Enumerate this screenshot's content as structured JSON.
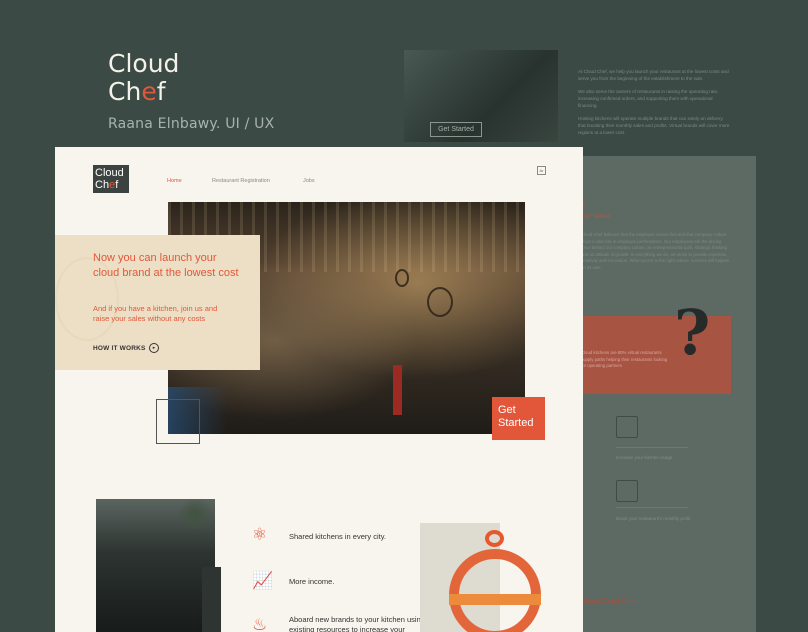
{
  "title_block": {
    "brand_line1": "Cloud",
    "brand_line2_pre": "Ch",
    "brand_line2_o": "e",
    "brand_line2_post": "f",
    "credit": "Raana Elnbawy.  UI / UX"
  },
  "bg_mock": {
    "get_started": "Get Started",
    "paragraphs": [
      "At Cloud Chef, we help you launch your restaurant at the lowest costs and serve you from the beginning of the establishment to the sale.",
      "We also serve the owners of restaurants in raising the operating rate, increasing confirmed orders, and supporting them with operational financing.",
      "Hosting kitchens will operate multiple brands that can solely an delivery that boosting their monthly sales and profits. Virtual brands will cover more regions at a lower cost."
    ]
  },
  "right_page": {
    "values_title": "Our Values",
    "values_text": "Cloud Chef believes that the employee comes first and that company culture plays a vital role in employee performance. Our employees are the driving force behind our company culture, an entrepreneurial spirit, strategic thinking and an attitude of growth. In everything we do, we strive to provide expertise, creativity and innovation. When you're in the right culture, success will happen on its own.",
    "red_text": "Cloud kitchens are 80% virtual restaurants supply paths helping their restaurants looking for operating partners",
    "item1": "Increase your kitchen usage",
    "item2": "Boost your restaurant's monthly profit",
    "about": "About Cloud Chef"
  },
  "page": {
    "logo_line1": "Cloud",
    "logo_line2_pre": "Ch",
    "logo_line2_o": "e",
    "logo_line2_post": "f",
    "nav": [
      "Home",
      "Restaurant Registration",
      "Jobs"
    ],
    "lang": "Ar",
    "headline": "Now you can launch your cloud brand at the lowest cost",
    "subheadline": "And if you have a kitchen, join us and raise your sales without any costs",
    "how": "HOW IT WORKS",
    "get_started_1": "Get",
    "get_started_2": "Started",
    "features": [
      "Shared kitchens in every city.",
      "More income.",
      "Aboard new brands to your kitchen using existing resources to increase your"
    ]
  },
  "colors": {
    "accent": "#e2573a",
    "dark": "#3b4a44",
    "cream": "#f7f5ee"
  }
}
